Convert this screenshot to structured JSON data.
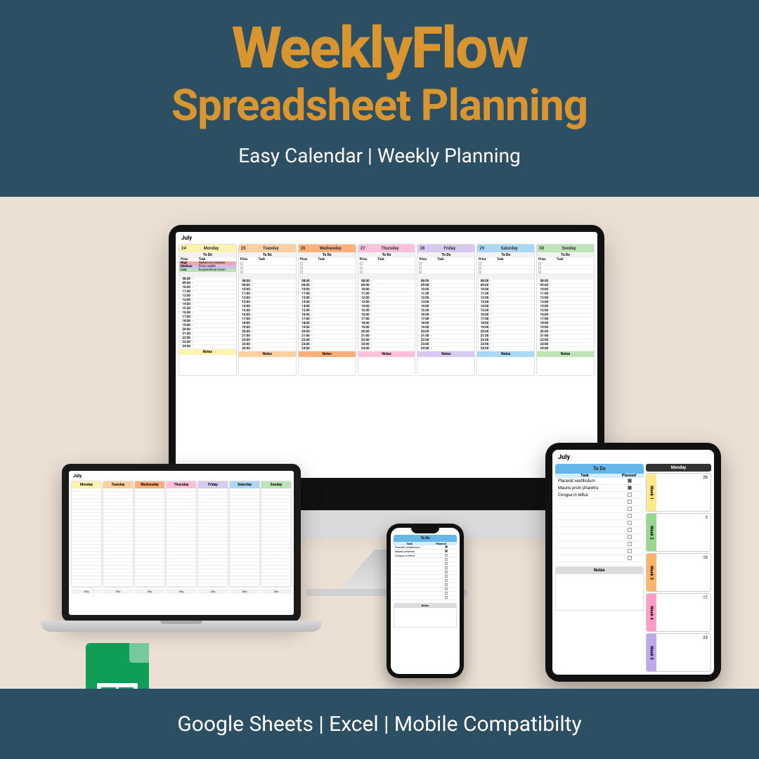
{
  "banner": {
    "title": "WeeklyFlow",
    "subtitle": "Spreadsheet Planning",
    "tagline": "Easy Calendar | Weekly Planning"
  },
  "footer": {
    "text": "Google Sheets | Excel | Mobile Compatibilty"
  },
  "imac": {
    "month": "July",
    "todo_label": "To Do",
    "days": [
      {
        "num": "24",
        "name": "Monday"
      },
      {
        "num": "25",
        "name": "Tuesday"
      },
      {
        "num": "26",
        "name": "Wednesday"
      },
      {
        "num": "27",
        "name": "Thursday"
      },
      {
        "num": "28",
        "name": "Friday"
      },
      {
        "num": "29",
        "name": "Saturday"
      },
      {
        "num": "30",
        "name": "Sunday"
      }
    ],
    "prios_header_left": "Prios",
    "prios_header_right": "Task",
    "mon_tasks": [
      {
        "p": "High",
        "t": "Nullam et molestie",
        "cls": "tag-red"
      },
      {
        "p": "Medium",
        "t": "Proin mattis",
        "cls": "tag-pur"
      },
      {
        "p": "Low",
        "t": "Suspendisse lorem",
        "cls": "tag-grn"
      }
    ],
    "times": [
      "08:00",
      "09:00",
      "10:00",
      "11:00",
      "12:00",
      "13:00",
      "14:00",
      "15:00",
      "16:00",
      "17:00",
      "18:00",
      "19:00",
      "20:00",
      "21:00",
      "22:00",
      "23:00",
      "24:00"
    ],
    "notes_label": "Notes"
  },
  "laptop": {
    "month": "July",
    "days": [
      "Monday",
      "Tuesday",
      "Wednesday",
      "Thursday",
      "Friday",
      "Saturday",
      "Sunday"
    ],
    "city_label": "City",
    "cities": [
      "City",
      "City",
      "City",
      "City",
      "City",
      "City",
      "City"
    ]
  },
  "ipad": {
    "month": "July",
    "todo_label": "To Do",
    "todo_cols": {
      "task": "Task",
      "planned": "Planned"
    },
    "tasks": [
      {
        "t": "Placerat vestibulum",
        "chk": true
      },
      {
        "t": "Mauris proin pharetra",
        "chk": true
      },
      {
        "t": "Congue in tellus",
        "chk": false
      }
    ],
    "empty_rows": 9,
    "notes_label": "Notes",
    "month_header": "Monday",
    "weeks": [
      {
        "label": "Week 1",
        "date": "26"
      },
      {
        "label": "Week 2",
        "date": "3"
      },
      {
        "label": "Week 3",
        "date": "10"
      },
      {
        "label": "Week 4",
        "date": "17"
      },
      {
        "label": "Week 5",
        "date": "24"
      }
    ]
  },
  "iphone": {
    "todo_label": "To Do",
    "todo_cols": {
      "task": "Task",
      "planned": "Planned"
    },
    "tasks": [
      {
        "t": "Placerat vestibulum",
        "chk": true
      },
      {
        "t": "Mauris pharetra",
        "chk": true
      },
      {
        "t": "Congue in tellus",
        "chk": false
      }
    ],
    "empty_rows": 10,
    "notes_label": "Notes"
  }
}
